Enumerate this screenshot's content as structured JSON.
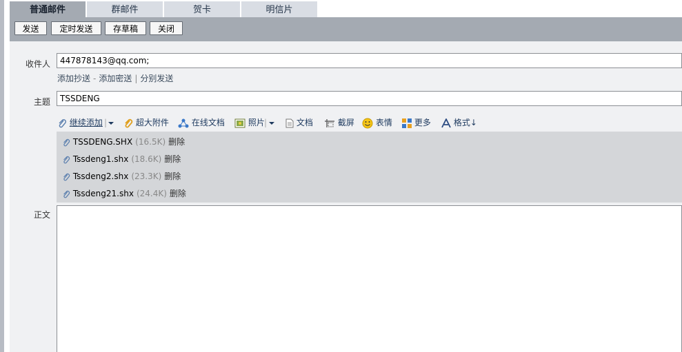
{
  "tabs": [
    {
      "label": "普通邮件",
      "active": true
    },
    {
      "label": "群邮件",
      "active": false
    },
    {
      "label": "贺卡",
      "active": false
    },
    {
      "label": "明信片",
      "active": false
    }
  ],
  "toolbar": {
    "send": "发送",
    "scheduled_send": "定时发送",
    "save_draft": "存草稿",
    "close": "关闭"
  },
  "compose": {
    "recipient_label": "收件人",
    "recipient_value": "447878143@qq.com;",
    "add_cc": "添加抄送",
    "add_bcc": "添加密送",
    "separate_send": "分别发送",
    "link_sep1": "-",
    "link_sep2": "|",
    "subject_label": "主题",
    "subject_value": "TSSDENG",
    "body_label": "正文"
  },
  "attach_toolbar": {
    "continue_add": "继续添加",
    "large_attachment": "超大附件",
    "online_doc": "在线文档",
    "photo": "照片",
    "document": "文档",
    "screenshot": "截屏",
    "emoji": "表情",
    "more": "更多",
    "format": "格式↓"
  },
  "attachments": [
    {
      "name": "TSSDENG.SHX",
      "size": "(16.5K)",
      "delete": "删除"
    },
    {
      "name": "Tssdeng1.shx",
      "size": "(18.6K)",
      "delete": "删除"
    },
    {
      "name": "Tssdeng2.shx",
      "size": "(23.3K)",
      "delete": "删除"
    },
    {
      "name": "Tssdeng21.shx",
      "size": "(24.4K)",
      "delete": "删除"
    }
  ],
  "colors": {
    "toolbar_bg": "#a4aab2",
    "tab_inactive": "#d9dde4",
    "attach_bg": "#d4d6d9",
    "form_bg": "#f0f1f3"
  }
}
